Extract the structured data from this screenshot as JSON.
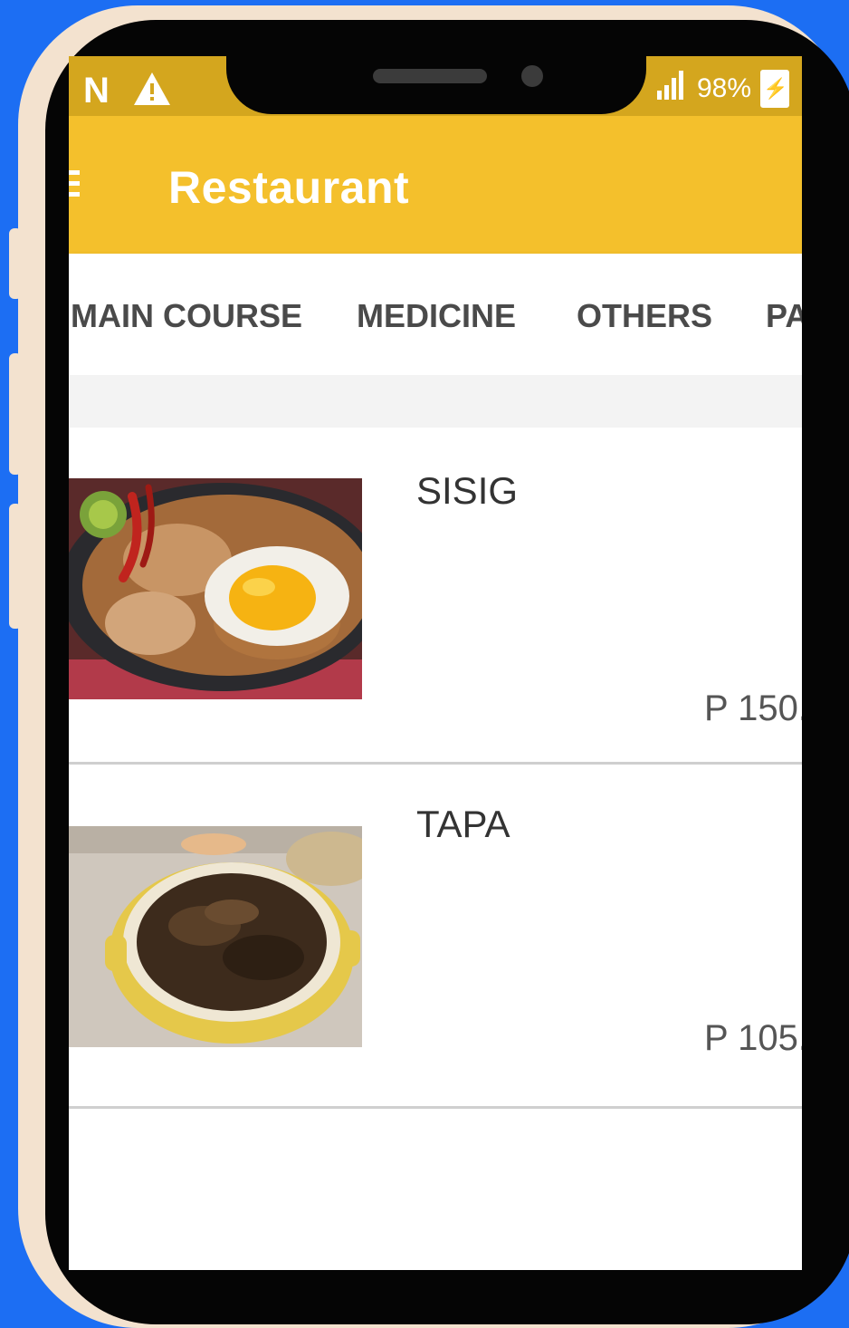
{
  "status_bar": {
    "left_icons": [
      "n-icon",
      "warning-icon"
    ],
    "battery_text": "98%",
    "signal_icon": "signal-icon",
    "battery_icon": "battery-charging-icon"
  },
  "app_bar": {
    "title": "Restaurant",
    "menu_icon": "menu-icon",
    "color": "#f4c02c"
  },
  "tabs": [
    {
      "label": "MAIN COURSE"
    },
    {
      "label": "MEDICINE"
    },
    {
      "label": "OTHERS"
    },
    {
      "label": "PA"
    }
  ],
  "items": [
    {
      "name": "SISIG",
      "price": "P 150.",
      "image": "sisig-photo"
    },
    {
      "name": "TAPA",
      "price": "P 105.",
      "image": "tapa-photo"
    }
  ],
  "colors": {
    "background": "#1c6ef3",
    "status_bar": "#d4a61e",
    "frame": "#f3e2cf"
  }
}
